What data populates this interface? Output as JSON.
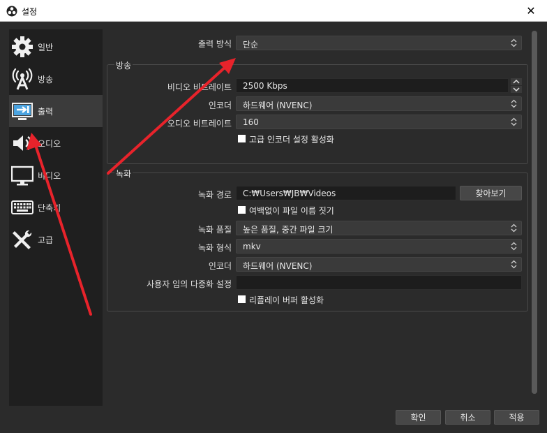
{
  "window": {
    "title": "설정",
    "close_glyph": "✕"
  },
  "sidebar": {
    "items": [
      {
        "label": "일반",
        "icon": "gear-icon",
        "active": false
      },
      {
        "label": "방송",
        "icon": "broadcast-tower-icon",
        "active": false
      },
      {
        "label": "출력",
        "icon": "output-monitor-arrow-icon",
        "active": true
      },
      {
        "label": "오디오",
        "icon": "speaker-icon",
        "active": false
      },
      {
        "label": "비디오",
        "icon": "monitor-icon",
        "active": false
      },
      {
        "label": "단축키",
        "icon": "keyboard-icon",
        "active": false
      },
      {
        "label": "고급",
        "icon": "tools-icon",
        "active": false
      }
    ]
  },
  "output_mode": {
    "label": "출력 방식",
    "value": "단순"
  },
  "streaming": {
    "title": "방송",
    "video_bitrate": {
      "label": "비디오 비트레이트",
      "value": "2500 Kbps"
    },
    "encoder": {
      "label": "인코더",
      "value": "하드웨어 (NVENC)"
    },
    "audio_bitrate": {
      "label": "오디오 비트레이트",
      "value": "160"
    },
    "advanced_encoder": {
      "label": "고급 인코더 설정 활성화"
    }
  },
  "recording": {
    "title": "녹화",
    "path": {
      "label": "녹화 경로",
      "value": "C:₩Users₩JB₩Videos",
      "browse_label": "찾아보기"
    },
    "no_space_filename": {
      "label": "여백없이 파일 이름 짓기"
    },
    "quality": {
      "label": "녹화 품질",
      "value": "높은 품질, 중간 파일 크기"
    },
    "format": {
      "label": "녹화 형식",
      "value": "mkv"
    },
    "encoder": {
      "label": "인코더",
      "value": "하드웨어 (NVENC)"
    },
    "custom_muxer": {
      "label": "사용자 임의 다중화 설정",
      "value": ""
    },
    "replay_buffer": {
      "label": "리플레이 버퍼 활성화"
    }
  },
  "footer": {
    "ok_label": "확인",
    "cancel_label": "취소",
    "apply_label": "적용"
  },
  "colors": {
    "annotation_arrow": "#e8232b",
    "sidebar_bg": "#1f1f1f",
    "window_bg": "#2b2b2b"
  }
}
